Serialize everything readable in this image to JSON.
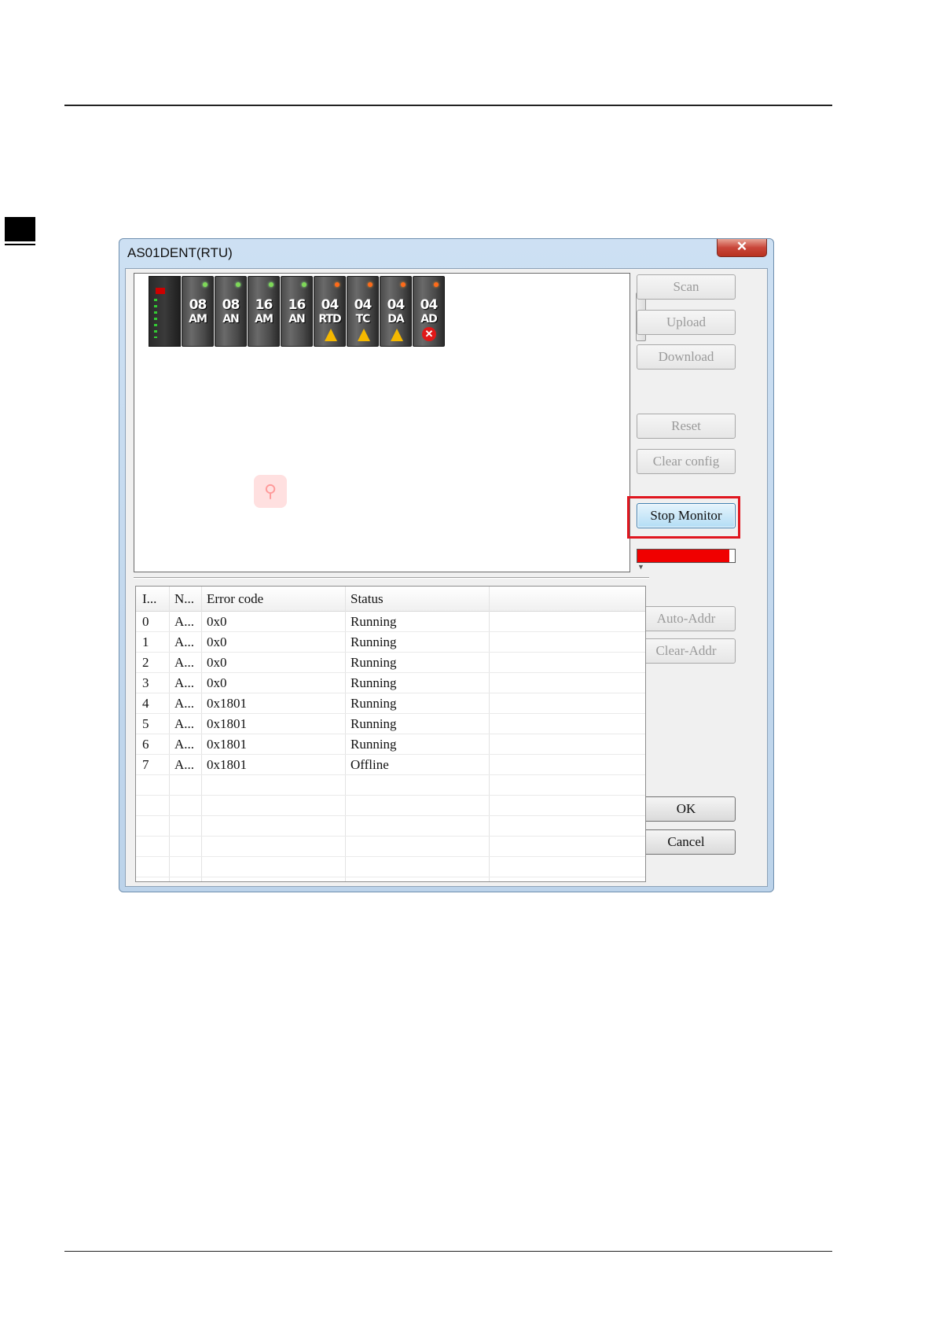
{
  "dialog": {
    "title": "AS01DENT(RTU)",
    "close_glyph": "✕"
  },
  "modules": [
    {
      "kind": "cpu"
    },
    {
      "kind": "io",
      "num": "08",
      "type": "AM",
      "led": "green",
      "badge": ""
    },
    {
      "kind": "io",
      "num": "08",
      "type": "AN",
      "led": "green",
      "badge": ""
    },
    {
      "kind": "io",
      "num": "16",
      "type": "AM",
      "led": "green",
      "badge": ""
    },
    {
      "kind": "io",
      "num": "16",
      "type": "AN",
      "led": "green",
      "badge": ""
    },
    {
      "kind": "io",
      "num": "04",
      "type": "RTD",
      "led": "orange",
      "badge": "warning"
    },
    {
      "kind": "io",
      "num": "04",
      "type": "TC",
      "led": "orange",
      "badge": "warning"
    },
    {
      "kind": "io",
      "num": "04",
      "type": "DA",
      "led": "orange",
      "badge": "warning"
    },
    {
      "kind": "io",
      "num": "04",
      "type": "AD",
      "led": "orange",
      "badge": "error"
    }
  ],
  "buttons": {
    "scan": "Scan",
    "upload": "Upload",
    "download": "Download",
    "reset": "Reset",
    "clear_config": "Clear config",
    "stop_monitor": "Stop Monitor",
    "auto_addr": "Auto-Addr",
    "clear_addr": "Clear-Addr",
    "ok": "OK",
    "cancel": "Cancel"
  },
  "progress": {
    "fraction": 0.94,
    "color": "#f00000"
  },
  "table": {
    "columns": [
      "I...",
      "N...",
      "Error code",
      "Status"
    ],
    "rows": [
      [
        "0",
        "A...",
        "0x0",
        "Running"
      ],
      [
        "1",
        "A...",
        "0x0",
        "Running"
      ],
      [
        "2",
        "A...",
        "0x0",
        "Running"
      ],
      [
        "3",
        "A...",
        "0x0",
        "Running"
      ],
      [
        "4",
        "A...",
        "0x1801",
        "Running"
      ],
      [
        "5",
        "A...",
        "0x1801",
        "Running"
      ],
      [
        "6",
        "A...",
        "0x1801",
        "Running"
      ],
      [
        "7",
        "A...",
        "0x1801",
        "Offline"
      ]
    ]
  },
  "colors": {
    "highlight": "#e0161f",
    "title_bar": "#cde0f3"
  }
}
